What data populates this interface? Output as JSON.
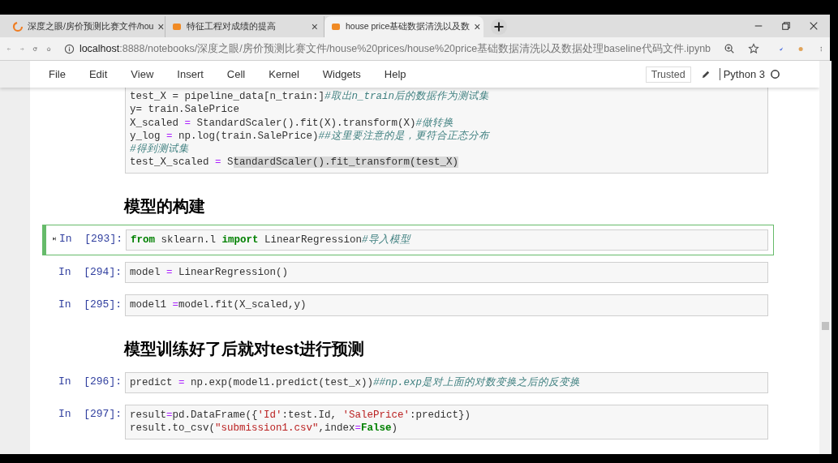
{
  "browser": {
    "tabs": [
      {
        "title": "深度之眼/房价预测比赛文件/hou",
        "selected": false,
        "close": "×"
      },
      {
        "title": "特征工程对成绩的提高",
        "selected": false,
        "close": "×"
      },
      {
        "title": "house price基础数据清洗以及数",
        "selected": true,
        "close": "×"
      }
    ],
    "url_host": "localhost",
    "url_rest": ":8888/notebooks/深度之眼/房价预测比赛文件/house%20prices/house%20price基础数据清洗以及数据处理baseline代码文件.ipynb"
  },
  "menu": [
    "File",
    "Edit",
    "View",
    "Insert",
    "Cell",
    "Kernel",
    "Widgets",
    "Help"
  ],
  "trusted": "Trusted",
  "kernel": "Python 3",
  "kernel_busy": false,
  "cells": [
    {
      "kind": "code",
      "selected": false,
      "lines": [
        [
          {
            "t": "test_X = pipeline_data[n_train:]",
            "kind": "code"
          },
          {
            "t": "#取出n_train后的数据作为测试集",
            "kind": "comment"
          }
        ],
        [
          {
            "t": "y= train.SalePrice",
            "kind": "code"
          }
        ],
        [
          {
            "t": "X_scaled ",
            "kind": "code"
          },
          {
            "t": "=",
            "kind": "op"
          },
          {
            "t": " StandardScaler().fit(X).transform(X)",
            "kind": "code"
          },
          {
            "t": "#做转换",
            "kind": "comment"
          }
        ],
        [
          {
            "t": "y_log ",
            "kind": "code"
          },
          {
            "t": "=",
            "kind": "op"
          },
          {
            "t": " np.log(train.SalePrice)",
            "kind": "code"
          },
          {
            "t": "##这里要注意的是，更符合正态分布",
            "kind": "comment"
          }
        ],
        [
          {
            "t": "#得到测试集",
            "kind": "comment"
          }
        ],
        [
          {
            "t": "test_X_scaled ",
            "kind": "code"
          },
          {
            "t": "=",
            "kind": "op"
          },
          {
            "t": " S",
            "kind": "code"
          },
          {
            "t": "tandardScaler().fit_transform(test_X)",
            "kind": "highlight"
          }
        ]
      ]
    },
    {
      "kind": "heading",
      "text": "模型的构建"
    },
    {
      "kind": "code",
      "prompt": "In  [293]:",
      "selected": true,
      "lines": [
        [
          {
            "t": "from",
            "kind": "keyword"
          },
          {
            "t": " sklearn.l ",
            "kind": "code"
          },
          {
            "t": "import",
            "kind": "keyword"
          },
          {
            "t": " LinearRegression",
            "kind": "code"
          },
          {
            "t": "#导入模型",
            "kind": "comment"
          }
        ]
      ]
    },
    {
      "kind": "code",
      "prompt": "In  [294]:",
      "selected": false,
      "lines": [
        [
          {
            "t": "model ",
            "kind": "code"
          },
          {
            "t": "=",
            "kind": "op"
          },
          {
            "t": " LinearRegression()",
            "kind": "code"
          }
        ]
      ]
    },
    {
      "kind": "code",
      "prompt": "In  [295]:",
      "selected": false,
      "lines": [
        [
          {
            "t": "model1 ",
            "kind": "code"
          },
          {
            "t": "=",
            "kind": "op"
          },
          {
            "t": "model.fit(X_scaled,y)",
            "kind": "code"
          }
        ]
      ]
    },
    {
      "kind": "heading",
      "text": "模型训练好了后就对test进行预测"
    },
    {
      "kind": "code",
      "prompt": "In  [296]:",
      "selected": false,
      "lines": [
        [
          {
            "t": "predict ",
            "kind": "code"
          },
          {
            "t": "=",
            "kind": "op"
          },
          {
            "t": " np.exp(model1.predict(test_x))",
            "kind": "code"
          },
          {
            "t": "##np.exp是对上面的对数变换之后的反变换",
            "kind": "comment"
          }
        ]
      ]
    },
    {
      "kind": "code",
      "prompt": "In  [297]:",
      "selected": false,
      "lines": [
        [
          {
            "t": "result",
            "kind": "code"
          },
          {
            "t": "=",
            "kind": "op"
          },
          {
            "t": "pd.DataFrame({",
            "kind": "code"
          },
          {
            "t": "'Id'",
            "kind": "string"
          },
          {
            "t": ":test.Id, ",
            "kind": "code"
          },
          {
            "t": "'SalePrice'",
            "kind": "string"
          },
          {
            "t": ":predict})",
            "kind": "code"
          }
        ],
        [
          {
            "t": "result.to_csv(",
            "kind": "code"
          },
          {
            "t": "\"submission1.csv\"",
            "kind": "string"
          },
          {
            "t": ",index",
            "kind": "code"
          },
          {
            "t": "=",
            "kind": "op"
          },
          {
            "t": "False",
            "kind": "constant"
          },
          {
            "t": ")",
            "kind": "code"
          }
        ]
      ]
    }
  ]
}
